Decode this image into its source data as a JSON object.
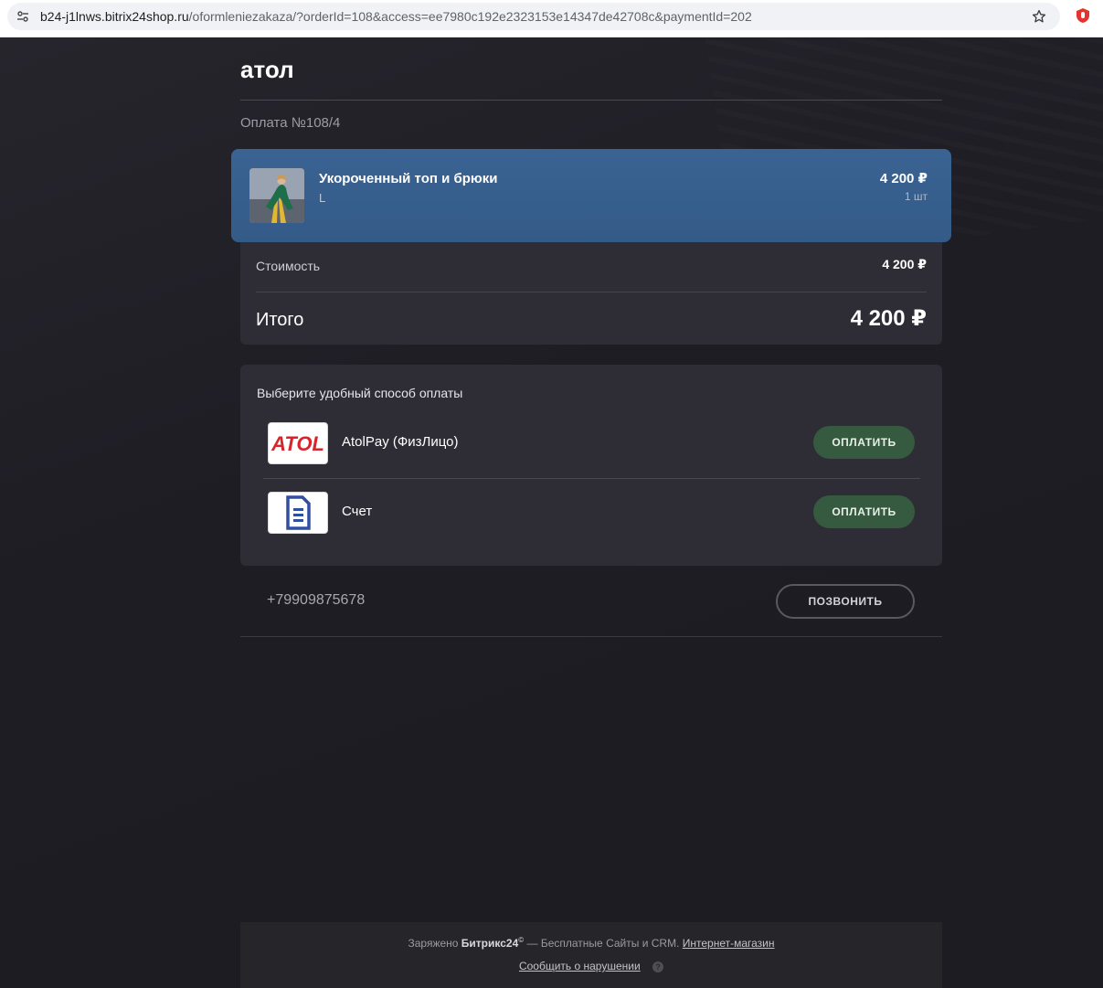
{
  "browser": {
    "url_host": "b24-j1lnws.bitrix24shop.ru",
    "url_path": "/oformleniezakaza/?orderId=108&access=ee7980c192e2323153e14347de42708c&paymentId=202"
  },
  "shop": {
    "title": "атол",
    "payment_number": "Оплата №108/4"
  },
  "product": {
    "name": "Укороченный топ и брюки",
    "size": "L",
    "price": "4 200 ₽",
    "quantity": "1 шт"
  },
  "summary": {
    "cost_label": "Стоимость",
    "cost_value": "4 200 ₽",
    "total_label": "Итого",
    "total_value": "4 200 ₽"
  },
  "payment_methods": {
    "title": "Выберите удобный способ оплаты",
    "items": [
      {
        "name": "AtolPay (ФизЛицо)",
        "logo_text": "ATOL",
        "button": "ОПЛАТИТЬ",
        "icon": "atol-logo"
      },
      {
        "name": "Счет",
        "button": "ОПЛАТИТЬ",
        "icon": "invoice-document-icon"
      }
    ]
  },
  "contact": {
    "phone": "+79909875678",
    "call_button": "ПОЗВОНИТЬ"
  },
  "footer": {
    "powered_prefix": "Заряжено",
    "brand": "Битрикс24",
    "brand_mark": "©",
    "tagline": "— Бесплатные Сайты и CRM.",
    "shop_link": "Интернет-магазин",
    "report_link": "Сообщить о нарушении",
    "help_glyph": "?"
  },
  "colors": {
    "background": "#1e1d24",
    "card": "#2e2d36",
    "product_card": "#3a6393",
    "pay_button": "#365a3f",
    "atol_red": "#d7262b",
    "invoice_blue": "#2f4fa2"
  }
}
